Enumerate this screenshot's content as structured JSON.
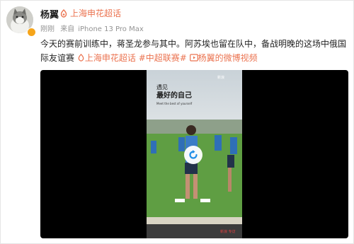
{
  "post": {
    "username": "杨翼",
    "topic_tag": "上海申花超话",
    "meta": {
      "time": "刚刚",
      "source_prefix": "来自",
      "device": "iPhone 13 Pro Max"
    },
    "text_part1": "今天的赛前训练中，蒋圣龙参与其中。阿苏埃也留在队中，备战明晚的这场中俄国际友谊赛",
    "hashtag1": "上海申花超话",
    "hashtag2": "#中超联赛#",
    "video_link": "杨翼的微博视频"
  },
  "video": {
    "caption_title": "遇见 最好的自己",
    "caption_sub": "Meet the best of yourself",
    "watermark": "新浪体育 新浪 专访",
    "state": "paused"
  },
  "colors": {
    "accent": "#eb7350",
    "text": "#222222",
    "meta": "#939393",
    "badge": "#f6a51a"
  },
  "icons": {
    "topic": "supertopic-icon",
    "video_link": "video-icon",
    "play": "play-icon",
    "verify": "verified-badge-icon"
  }
}
